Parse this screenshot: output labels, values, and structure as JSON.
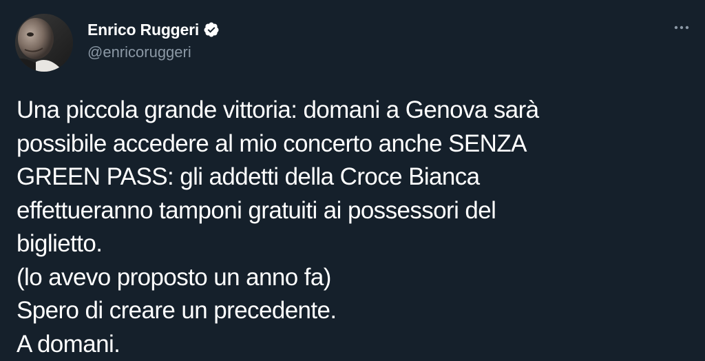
{
  "author": {
    "display_name": "Enrico Ruggeri",
    "handle": "@enricoruggeri",
    "verified": true,
    "avatar_icon": "avatar-photo"
  },
  "menu": {
    "icon": "more-options-icon"
  },
  "tweet": {
    "lines": [
      "Una piccola grande vittoria: domani a Genova sarà",
      "possibile accedere al mio concerto anche SENZA",
      "GREEN PASS: gli addetti della Croce Bianca",
      "effettueranno tamponi gratuiti ai possessori del",
      "biglietto.",
      "(lo avevo proposto un anno fa)",
      "Spero di creare un precedente.",
      "A domani."
    ]
  },
  "colors": {
    "background": "#15202b",
    "text": "#ffffff",
    "secondary_text": "#8b98a5",
    "verified_badge": "#ffffff"
  }
}
